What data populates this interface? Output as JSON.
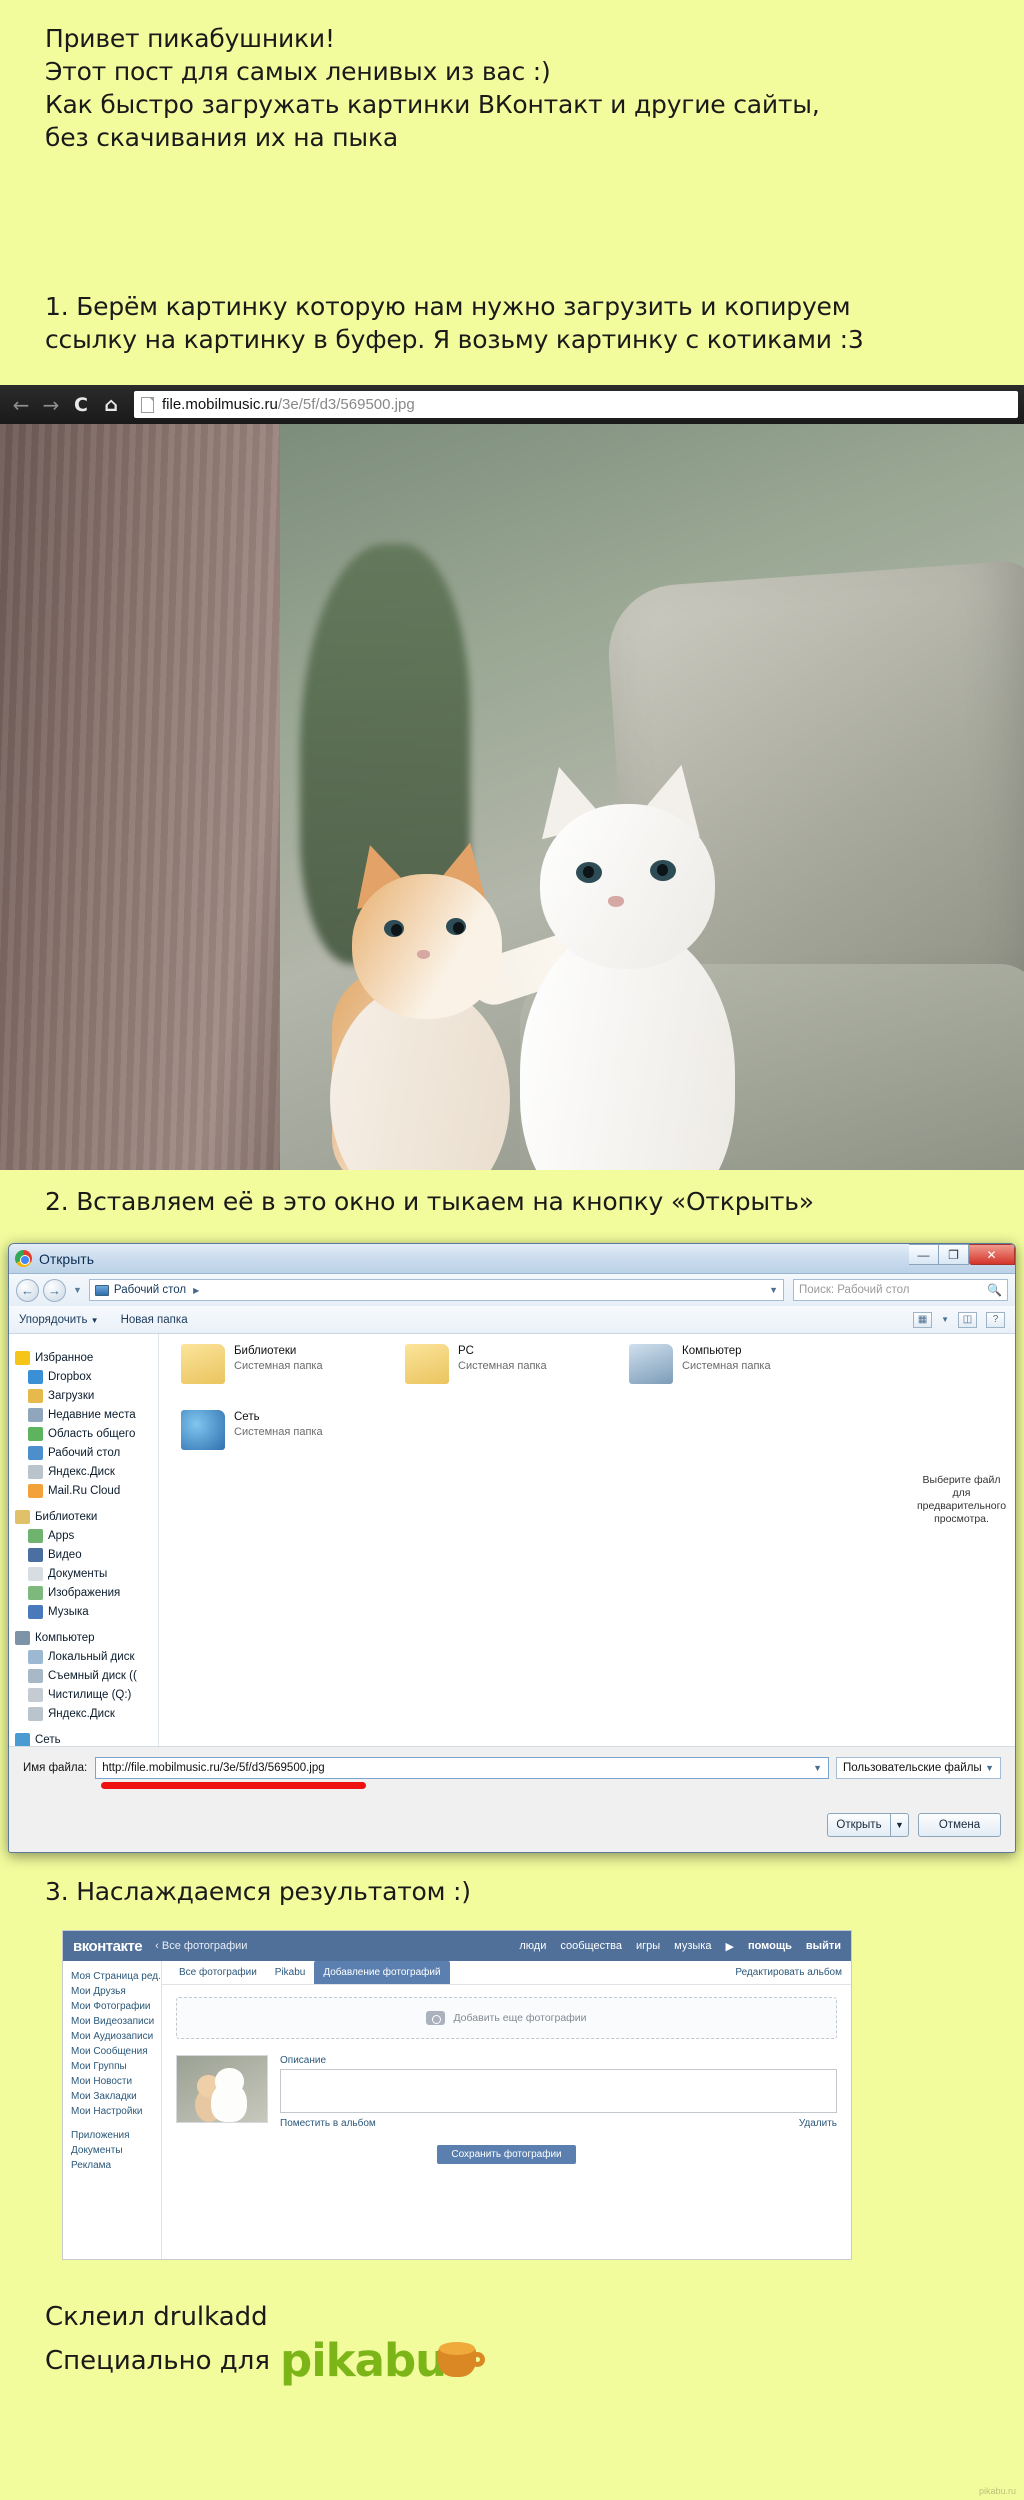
{
  "theme": {
    "background": "#F2FC9C",
    "text": "#1a1a1a",
    "accent_green": "#7cb518",
    "vk_blue": "#50709a",
    "red": "#ef1111"
  },
  "intro": {
    "line1": "Привет пикабушники!",
    "line2": "Этот пост для самых ленивых из вас :)",
    "line3": "Как быстро загружать картинки ВКонтакт и другие сайты,",
    "line4": "без скачивания их на пыка"
  },
  "steps": {
    "step1_line1": "1. Берём картинку которую нам нужно загрузить и копируем",
    "step1_line2": "ссылку на картинку в буфер. Я возьму картинку с котиками :3",
    "step2": "2. Вставляем её в это окно и тыкаем на кнопку «Открыть»",
    "step3": "3. Наслаждаемся результатом :)"
  },
  "browser": {
    "back_icon": "back-arrow",
    "forward_icon": "forward-arrow",
    "reload_icon": "C",
    "home_icon": "home",
    "url_domain": "file.mobilmusic.ru",
    "url_path": "/3e/5f/d3/569500.jpg",
    "page_icon": "document-icon"
  },
  "dialog": {
    "title": "Открыть",
    "window_buttons": {
      "minimize": "—",
      "maximize": "❐",
      "close": "✕"
    },
    "breadcrumb": "Рабочий стол",
    "breadcrumb_caret": "▶",
    "search_placeholder": "Поиск: Рабочий стол",
    "toolbar": {
      "organize": "Упорядочить",
      "organize_caret": "▼",
      "new_folder": "Новая папка"
    },
    "sidebar": [
      {
        "label": "Избранное",
        "level": "group",
        "icon": "star-icon",
        "color": "#f5c518"
      },
      {
        "label": "Dropbox",
        "level": "child",
        "icon": "dropbox-icon",
        "color": "#3b8fd6"
      },
      {
        "label": "Загрузки",
        "level": "child",
        "icon": "downloads-icon",
        "color": "#e7b84b"
      },
      {
        "label": "Недавние места",
        "level": "child",
        "icon": "recent-places-icon",
        "color": "#8fa6bd"
      },
      {
        "label": "Область общего",
        "level": "child",
        "icon": "shared-folder-icon",
        "color": "#5eb35e"
      },
      {
        "label": "Рабочий стол",
        "level": "child",
        "icon": "desktop-icon",
        "color": "#4d8fcd"
      },
      {
        "label": "Яндекс.Диск",
        "level": "child",
        "icon": "yandex-disk-icon",
        "color": "#b9c4cd"
      },
      {
        "label": "Mail.Ru Cloud",
        "level": "child",
        "icon": "mailru-cloud-icon",
        "color": "#f2a13b"
      },
      {
        "label": "Библиотеки",
        "level": "group",
        "icon": "libraries-icon",
        "color": "#e0c068"
      },
      {
        "label": "Apps",
        "level": "child",
        "icon": "apps-folder-icon",
        "color": "#6fb36f"
      },
      {
        "label": "Видео",
        "level": "child",
        "icon": "video-icon",
        "color": "#4a6fa0"
      },
      {
        "label": "Документы",
        "level": "child",
        "icon": "documents-icon",
        "color": "#d8dde3"
      },
      {
        "label": "Изображения",
        "level": "child",
        "icon": "pictures-icon",
        "color": "#7db87d"
      },
      {
        "label": "Музыка",
        "level": "child",
        "icon": "music-icon",
        "color": "#4a79bb"
      },
      {
        "label": "Компьютер",
        "level": "group",
        "icon": "computer-icon",
        "color": "#7d93a8"
      },
      {
        "label": "Локальный диск",
        "level": "child",
        "icon": "local-disk-icon",
        "color": "#9db8d2"
      },
      {
        "label": "Съемный диск ((",
        "level": "child",
        "icon": "removable-disk-icon",
        "color": "#a8b8c6"
      },
      {
        "label": "Чистилище (Q:)",
        "level": "child",
        "icon": "drive-icon",
        "color": "#c4cbd2"
      },
      {
        "label": "Яндекс.Диск",
        "level": "child",
        "icon": "yandex-disk-icon",
        "color": "#b9c4cd"
      },
      {
        "label": "Сеть",
        "level": "group",
        "icon": "network-icon",
        "color": "#4a9bd1"
      }
    ],
    "files": [
      {
        "name": "Библиотеки",
        "sub": "Системная папка",
        "icon": "libraries-folder-icon"
      },
      {
        "name": "PC",
        "sub": "Системная папка",
        "icon": "user-folder-icon"
      },
      {
        "name": "Компьютер",
        "sub": "Системная папка",
        "icon": "computer-folder-icon"
      },
      {
        "name": "Сеть",
        "sub": "Системная папка",
        "icon": "network-folder-icon"
      }
    ],
    "preview_text": "Выберите файл для предварительного просмотра.",
    "filename_label": "Имя файла:",
    "filename_value": "http://file.mobilmusic.ru/3e/5f/d3/569500.jpg",
    "filetype_value": "Пользовательские файлы",
    "open_button": "Открыть",
    "open_caret": "▼",
    "cancel_button": "Отмена"
  },
  "vk": {
    "logo_v": "в",
    "logo_rest": "контакте",
    "back_label": "Все фотографии",
    "nav": [
      {
        "label": "люди"
      },
      {
        "label": "сообщества"
      },
      {
        "label": "игры"
      },
      {
        "label": "музыка"
      },
      {
        "label": "▶"
      },
      {
        "label": "помощь"
      },
      {
        "label": "выйти"
      }
    ],
    "sidebar": [
      "Моя Страница      ред.",
      "Мои Друзья",
      "Мои Фотографии",
      "Мои Видеозаписи",
      "Мои Аудиозаписи",
      "Мои Сообщения",
      "Мои Группы",
      "Мои Новости",
      "Мои Закладки",
      "Мои Настройки"
    ],
    "sidebar2": [
      "Приложения",
      "Документы",
      "Реклама"
    ],
    "tabs": [
      {
        "label": "Все фотографии",
        "active": false
      },
      {
        "label": "Pikabu",
        "active": false
      },
      {
        "label": "Добавление фотографий",
        "active": true
      }
    ],
    "edit_album": "Редактировать альбом",
    "dropzone": "Добавить еще фотографии",
    "description_label": "Описание",
    "move_to_album": "Поместить в альбом",
    "delete": "Удалить",
    "save_button": "Сохранить фотографии"
  },
  "footer": {
    "line1": "Склеил drulkadd",
    "line2": "Специально для",
    "logo": "pikabu",
    "watermark": "pikabu.ru"
  }
}
